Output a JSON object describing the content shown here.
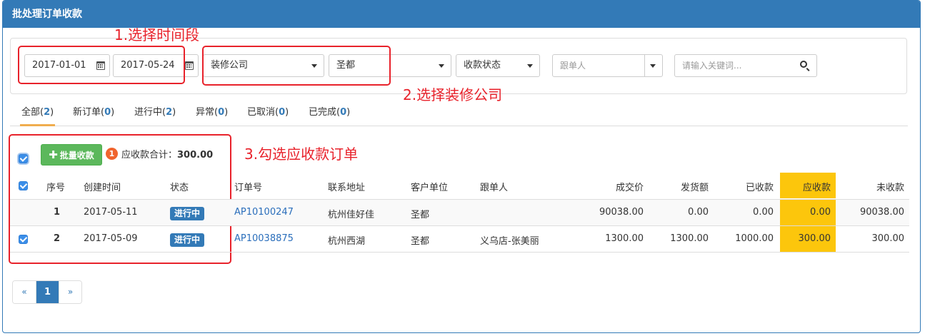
{
  "panel": {
    "title": "批处理订单收款"
  },
  "filters": {
    "date_start": "2017-01-01",
    "date_end": "2017-05-24",
    "company": "装修公司",
    "sub_company": "圣都",
    "payment_status": "收款状态",
    "follower_placeholder": "跟单人",
    "keyword_placeholder": "请输入关键词..."
  },
  "annotations": {
    "step1": "1.选择时间段",
    "step2": "2.选择装修公司",
    "step3": "3.勾选应收款订单"
  },
  "tabs": [
    {
      "label": "全部",
      "count": "2"
    },
    {
      "label": "新订单",
      "count": "0"
    },
    {
      "label": "进行中",
      "count": "2"
    },
    {
      "label": "异常",
      "count": "0"
    },
    {
      "label": "已取消",
      "count": "0"
    },
    {
      "label": "已完成",
      "count": "0"
    }
  ],
  "batch": {
    "button_label": "批量收款",
    "selected_count": "1",
    "sum_label": "应收款合计：",
    "sum_value": "300.00"
  },
  "table": {
    "columns": [
      "序号",
      "创建时间",
      "状态",
      "订单号",
      "联系地址",
      "客户单位",
      "跟单人",
      "成交价",
      "发货额",
      "已收款",
      "应收款",
      "未收款"
    ],
    "rows": [
      {
        "no": "1",
        "created": "2017-05-11",
        "status": "进行中",
        "order_no": "AP10100247",
        "address": "杭州佳好佳",
        "customer": "圣都",
        "follower": "",
        "deal_price": "90038.00",
        "shipped": "0.00",
        "received": "0.00",
        "receivable": "0.00",
        "unpaid": "90038.00",
        "checked": false
      },
      {
        "no": "2",
        "created": "2017-05-09",
        "status": "进行中",
        "order_no": "AP10038875",
        "address": "杭州西湖",
        "customer": "圣都",
        "follower": "义乌店-张美丽",
        "deal_price": "1300.00",
        "shipped": "1300.00",
        "received": "1000.00",
        "receivable": "300.00",
        "unpaid": "300.00",
        "checked": true
      }
    ]
  },
  "pagination": {
    "prev": "«",
    "current": "1",
    "next": "»"
  },
  "colors": {
    "primary": "#337ab7",
    "highlight": "#fcc60c",
    "annotation": "#e8222b",
    "success": "#5cb85c"
  }
}
